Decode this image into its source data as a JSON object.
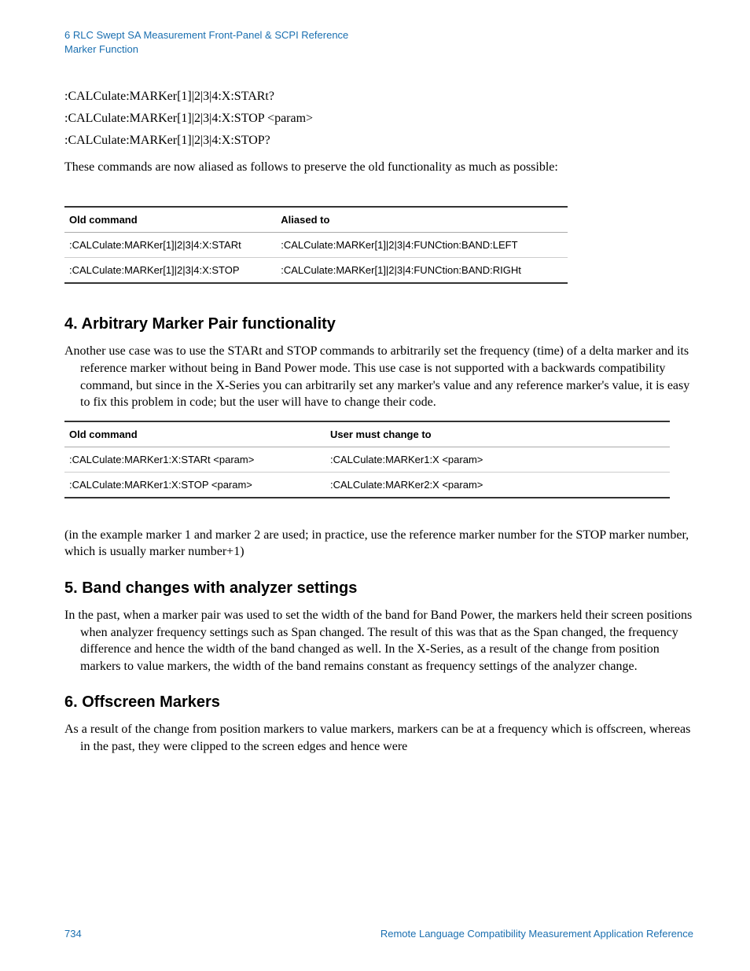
{
  "header": {
    "line1": "6 RLC Swept SA Measurement Front-Panel & SCPI Reference",
    "line2": "Marker Function"
  },
  "commands": [
    ":CALCulate:MARKer[1]|2|3|4:X:STARt?",
    ":CALCulate:MARKer[1]|2|3|4:X:STOP <param>",
    ":CALCulate:MARKer[1]|2|3|4:X:STOP?"
  ],
  "alias_intro": "These commands are now aliased as follows to preserve the old functionality as much as possible:",
  "table1": {
    "headers": [
      "Old command",
      "Aliased to"
    ],
    "rows": [
      [
        ":CALCulate:MARKer[1]|2|3|4:X:STARt",
        ":CALCulate:MARKer[1]|2|3|4:FUNCtion:BAND:LEFT"
      ],
      [
        ":CALCulate:MARKer[1]|2|3|4:X:STOP",
        ":CALCulate:MARKer[1]|2|3|4:FUNCtion:BAND:RIGHt"
      ]
    ]
  },
  "section4": {
    "title": "4. Arbitrary Marker Pair functionality",
    "body": "Another use case was to use the STARt and STOP commands to arbitrarily set the frequency (time) of a delta marker and its reference marker without being in Band Power mode. This use case is not supported with a backwards compatibility command, but since in the X-Series you can arbitrarily set any marker's value and any reference marker's value, it is easy to fix this problem in code; but the user will have to change their code."
  },
  "table2": {
    "headers": [
      "Old command",
      "User must change to"
    ],
    "rows": [
      [
        ":CALCulate:MARKer1:X:STARt <param>",
        ":CALCulate:MARKer1:X <param>"
      ],
      [
        ":CALCulate:MARKer1:X:STOP <param>",
        ":CALCulate:MARKer2:X <param>"
      ]
    ]
  },
  "table2_note": "(in the example marker 1 and marker 2 are used; in practice, use the reference marker number for the STOP marker number, which is usually marker number+1)",
  "section5": {
    "title": "5. Band changes with analyzer settings",
    "body": "In the past, when a marker pair was used to set the width of the band for Band Power, the markers held their screen positions when analyzer frequency settings such as Span changed. The result of this was that as the Span changed, the frequency difference and hence the width of the band changed as well. In the X-Series, as a result of the change from position markers to value markers, the width of the band remains constant as frequency settings of the analyzer change."
  },
  "section6": {
    "title": "6. Offscreen Markers",
    "body": "As a result of the change from position markers to value markers, markers can be at a frequency which is offscreen, whereas in the past, they were clipped to the screen edges and hence were"
  },
  "footer": {
    "page": "734",
    "doc_title": "Remote Language Compatibility Measurement Application Reference"
  }
}
